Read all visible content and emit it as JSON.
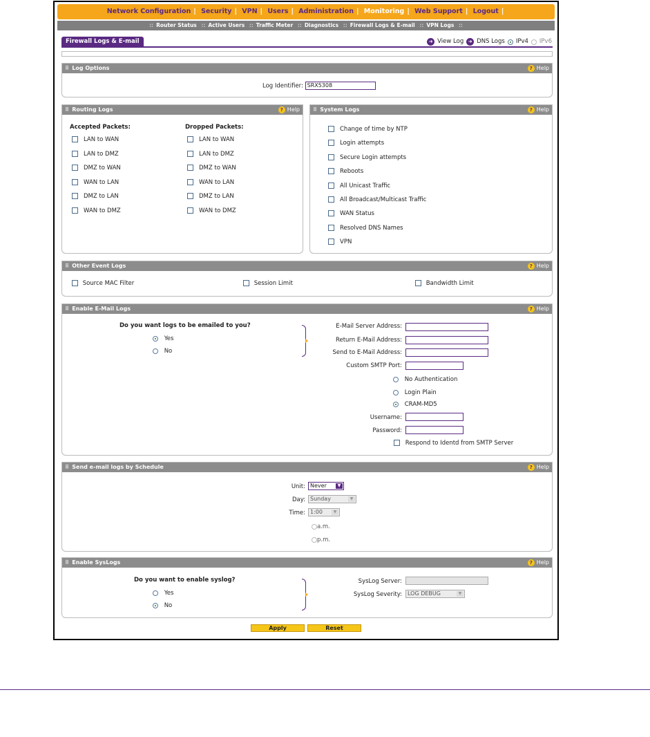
{
  "nav": {
    "primary": [
      "Network Configuration",
      "Security",
      "VPN",
      "Users",
      "Administration",
      "Monitoring",
      "Web Support",
      "Logout"
    ],
    "secondary": [
      "Router Status",
      "Active Users",
      "Traffic Meter",
      "Diagnostics",
      "Firewall Logs & E-mail",
      "VPN Logs"
    ]
  },
  "tab": "Firewall Logs & E-mail",
  "toplinks": {
    "view_log": "View Log",
    "dns_logs": "DNS Logs",
    "ipv4": "IPv4",
    "ipv6": "IPv6"
  },
  "help": "Help",
  "log_options": {
    "title": "Log Options",
    "identifier_label": "Log Identifier:",
    "identifier_value": "SRX5308"
  },
  "routing_logs": {
    "title": "Routing Logs",
    "accepted_title": "Accepted Packets:",
    "dropped_title": "Dropped Packets:",
    "items": [
      "LAN to WAN",
      "LAN to DMZ",
      "DMZ to WAN",
      "WAN to LAN",
      "DMZ to LAN",
      "WAN to DMZ"
    ]
  },
  "system_logs": {
    "title": "System Logs",
    "items": [
      "Change of time by NTP",
      "Login attempts",
      "Secure Login attempts",
      "Reboots",
      "All Unicast Traffic",
      "All Broadcast/Multicast Traffic",
      "WAN Status",
      "Resolved DNS Names",
      "VPN"
    ]
  },
  "other_logs": {
    "title": "Other Event Logs",
    "items": [
      "Source MAC Filter",
      "Session Limit",
      "Bandwidth Limit"
    ]
  },
  "email_logs": {
    "title": "Enable E-Mail Logs",
    "question": "Do you want logs to be emailed to you?",
    "yes": "Yes",
    "no": "No",
    "server_label": "E-Mail Server Address:",
    "return_label": "Return E-Mail Address:",
    "send_label": "Send to E-Mail Address:",
    "port_label": "Custom SMTP Port:",
    "auth_none": "No Authentication",
    "auth_plain": "Login Plain",
    "auth_cram": "CRAM-MD5",
    "username_label": "Username:",
    "password_label": "Password:",
    "identd_label": "Respond to Identd from SMTP Server"
  },
  "schedule": {
    "title": "Send e-mail logs by Schedule",
    "unit_label": "Unit:",
    "unit_value": "Never",
    "day_label": "Day:",
    "day_value": "Sunday",
    "time_label": "Time:",
    "time_value": "1:00",
    "am": "a.m.",
    "pm": "p.m."
  },
  "syslog": {
    "title": "Enable SysLogs",
    "question": "Do you want to enable syslog?",
    "yes": "Yes",
    "no": "No",
    "server_label": "SysLog Server:",
    "severity_label": "SysLog Severity:",
    "severity_value": "LOG DEBUG"
  },
  "buttons": {
    "apply": "Apply",
    "reset": "Reset"
  }
}
